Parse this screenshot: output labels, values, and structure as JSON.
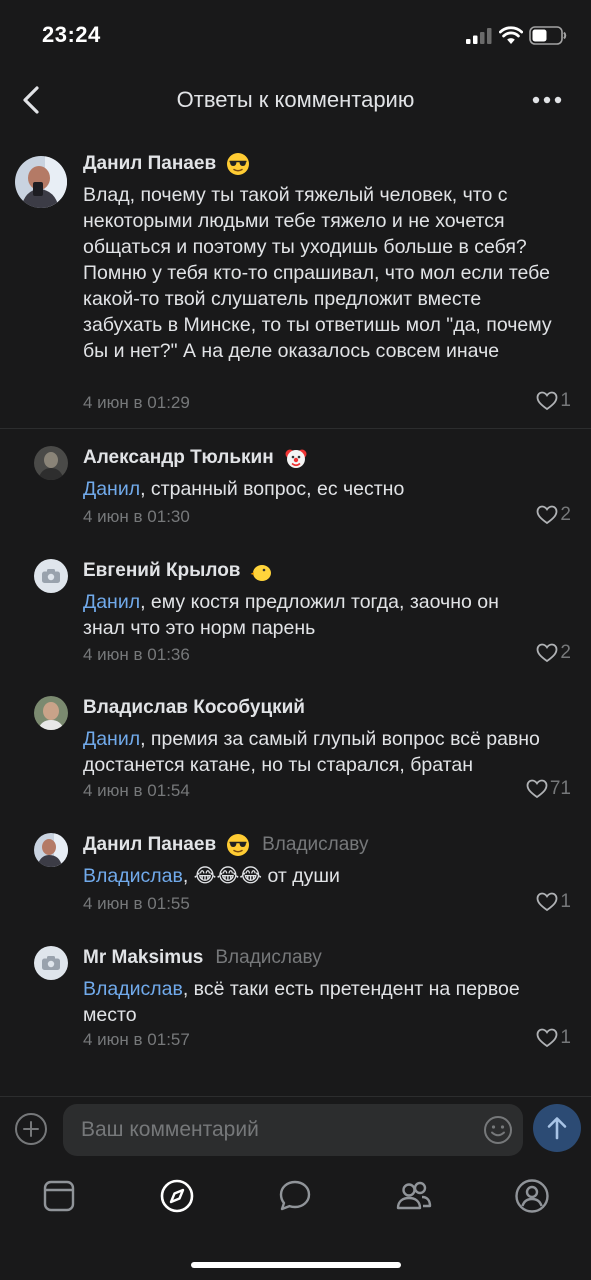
{
  "status": {
    "time": "23:24"
  },
  "header": {
    "title": "Ответы к комментарию"
  },
  "comments": [
    {
      "author": "Данил Панаев",
      "emoji": "cool-sunglasses-emoji",
      "text": "Влад, почему ты такой тяжелый человек, что с некоторыми людьми тебе тяжело и не хочется общаться и поэтому ты уходишь больше в себя? Помню у тебя кто-то спрашивал, что мол если тебе какой-то твой слушатель предложит вместе забухать в Минске, то ты ответишь мол \"да, почему бы и нет?\" А на деле оказалось совсем иначе",
      "date": "4 июн в 01:29",
      "likes": "1"
    },
    {
      "author": "Александр Тюлькин",
      "emoji": "clown-face-emoji",
      "mention": "Данил",
      "text": ", странный вопрос, ес честно",
      "date": "4 июн в 01:30",
      "likes": "2"
    },
    {
      "author": "Евгений Крылов",
      "emoji": "baby-chick-emoji",
      "mention": "Данил",
      "text": ", ему костя предложил тогда, заочно он знал что это норм парень",
      "date": "4 июн в 01:36",
      "likes": "2"
    },
    {
      "author": "Владислав Кособуцкий",
      "mention": "Данил",
      "text": ", премия за самый глупый вопрос всё равно достанется катане, но ты старался, братан",
      "date": "4 июн в 01:54",
      "likes": "71"
    },
    {
      "author": "Данил Панаев",
      "emoji": "cool-sunglasses-emoji",
      "reply_to": "Владиславу",
      "mention": "Владислав",
      "text": ", 😂😂😂 от души",
      "date": "4 июн в 01:55",
      "likes": "1"
    },
    {
      "author": "Mr Maksimus",
      "reply_to": "Владиславу",
      "mention": "Владислав",
      "text": ", всё таки есть претендент на первое место",
      "date": "4 июн в 01:57",
      "likes": "1"
    }
  ],
  "composer": {
    "placeholder": "Ваш комментарий"
  },
  "tabs": [
    "news-icon",
    "discover-icon",
    "messages-icon",
    "friends-icon",
    "profile-icon"
  ],
  "colors": {
    "background": "#19191a",
    "accent": "#71aaeb",
    "muted": "#76787a",
    "send": "#2c4b74"
  }
}
